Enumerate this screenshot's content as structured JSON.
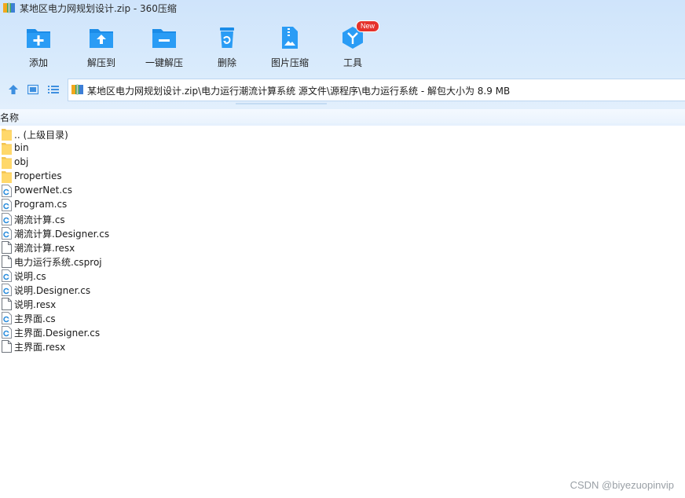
{
  "window": {
    "title": "某地区电力网规划设计.zip - 360压缩"
  },
  "toolbar": {
    "buttons": [
      {
        "label": "添加",
        "icon": "add-icon"
      },
      {
        "label": "解压到",
        "icon": "extract-to-icon"
      },
      {
        "label": "一键解压",
        "icon": "one-click-extract-icon"
      },
      {
        "label": "删除",
        "icon": "delete-icon"
      },
      {
        "label": "图片压缩",
        "icon": "image-compress-icon"
      },
      {
        "label": "工具",
        "icon": "tools-icon",
        "badge": "New"
      }
    ]
  },
  "address": {
    "path": "某地区电力网规划设计.zip\\电力运行潮流计算系统 源文件\\源程序\\电力运行系统 - 解包大小为 8.9 MB"
  },
  "list": {
    "column_name": "名称",
    "items": [
      {
        "name": ".. (上级目录)",
        "type": "folder"
      },
      {
        "name": "bin",
        "type": "folder"
      },
      {
        "name": "obj",
        "type": "folder"
      },
      {
        "name": "Properties",
        "type": "folder"
      },
      {
        "name": "PowerNet.cs",
        "type": "cs"
      },
      {
        "name": "Program.cs",
        "type": "cs"
      },
      {
        "name": "潮流计算.cs",
        "type": "cs"
      },
      {
        "name": "潮流计算.Designer.cs",
        "type": "cs"
      },
      {
        "name": "潮流计算.resx",
        "type": "file"
      },
      {
        "name": "电力运行系统.csproj",
        "type": "file"
      },
      {
        "name": "说明.cs",
        "type": "cs"
      },
      {
        "name": "说明.Designer.cs",
        "type": "cs"
      },
      {
        "name": "说明.resx",
        "type": "file"
      },
      {
        "name": "主界面.cs",
        "type": "cs"
      },
      {
        "name": "主界面.Designer.cs",
        "type": "cs"
      },
      {
        "name": "主界面.resx",
        "type": "file"
      }
    ]
  },
  "watermark": "CSDN @biyezuopinvip",
  "colors": {
    "accent": "#1b8ce8",
    "chrome": "#d9ebfc",
    "folder": "#ffd86b",
    "badge": "#e5322b"
  }
}
